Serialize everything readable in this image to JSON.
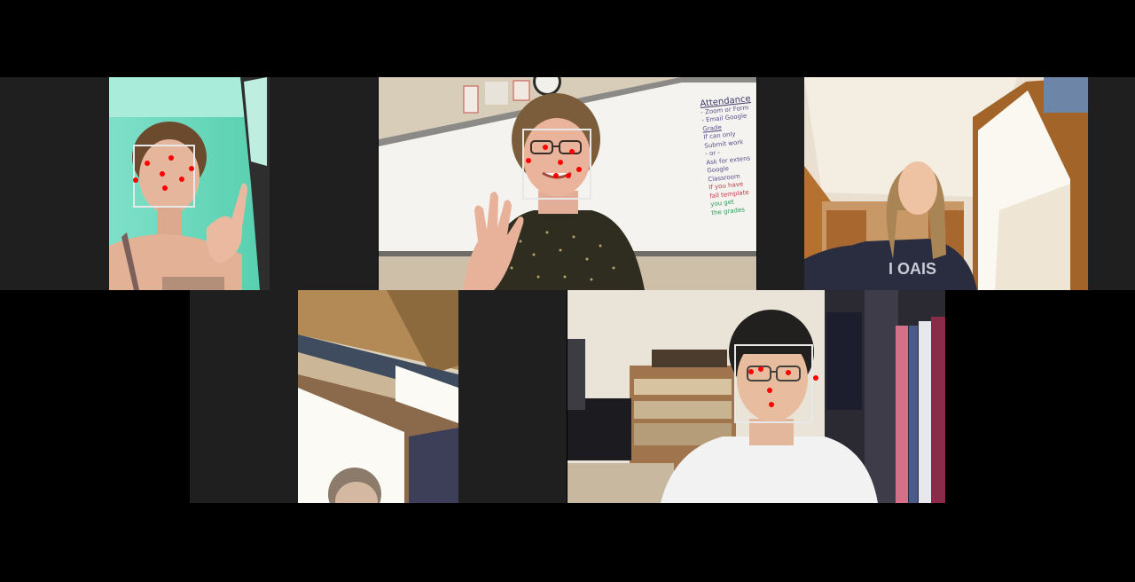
{
  "meeting": {
    "layout": "gallery",
    "background_color": "#000000",
    "tile_background_color": "#1f1f1f",
    "face_box_color": "#e8e8e8",
    "landmark_color": "#ff0000"
  },
  "participants": [
    {
      "id": "p1",
      "name": "",
      "scene": "teal wall, hand sign",
      "video_on": true,
      "face_detected": true,
      "landmark_count": 7
    },
    {
      "id": "p2",
      "name": "",
      "scene": "whiteboard classroom, waving",
      "video_on": true,
      "face_detected": true,
      "landmark_count": 7
    },
    {
      "id": "p3",
      "name": "",
      "scene": "doorway, window light",
      "video_on": true,
      "face_detected": false,
      "landmark_count": 0
    },
    {
      "id": "p4",
      "name": "",
      "scene": "ceiling and window",
      "video_on": true,
      "face_detected": false,
      "landmark_count": 0
    },
    {
      "id": "p5",
      "name": "",
      "scene": "bedroom with closet",
      "video_on": true,
      "face_detected": true,
      "landmark_count": 6
    }
  ],
  "whiteboard_text": {
    "heading": "Attendance",
    "lines": [
      "- Zoom or Form",
      "- Email Google",
      "Grade",
      "If can only",
      "Submit work",
      "- or -",
      "Ask for extens",
      "Google Classroom",
      "If you have",
      "fall template",
      "you get",
      "the grades"
    ]
  },
  "icons": {
    "clock": "wall-clock-icon"
  }
}
